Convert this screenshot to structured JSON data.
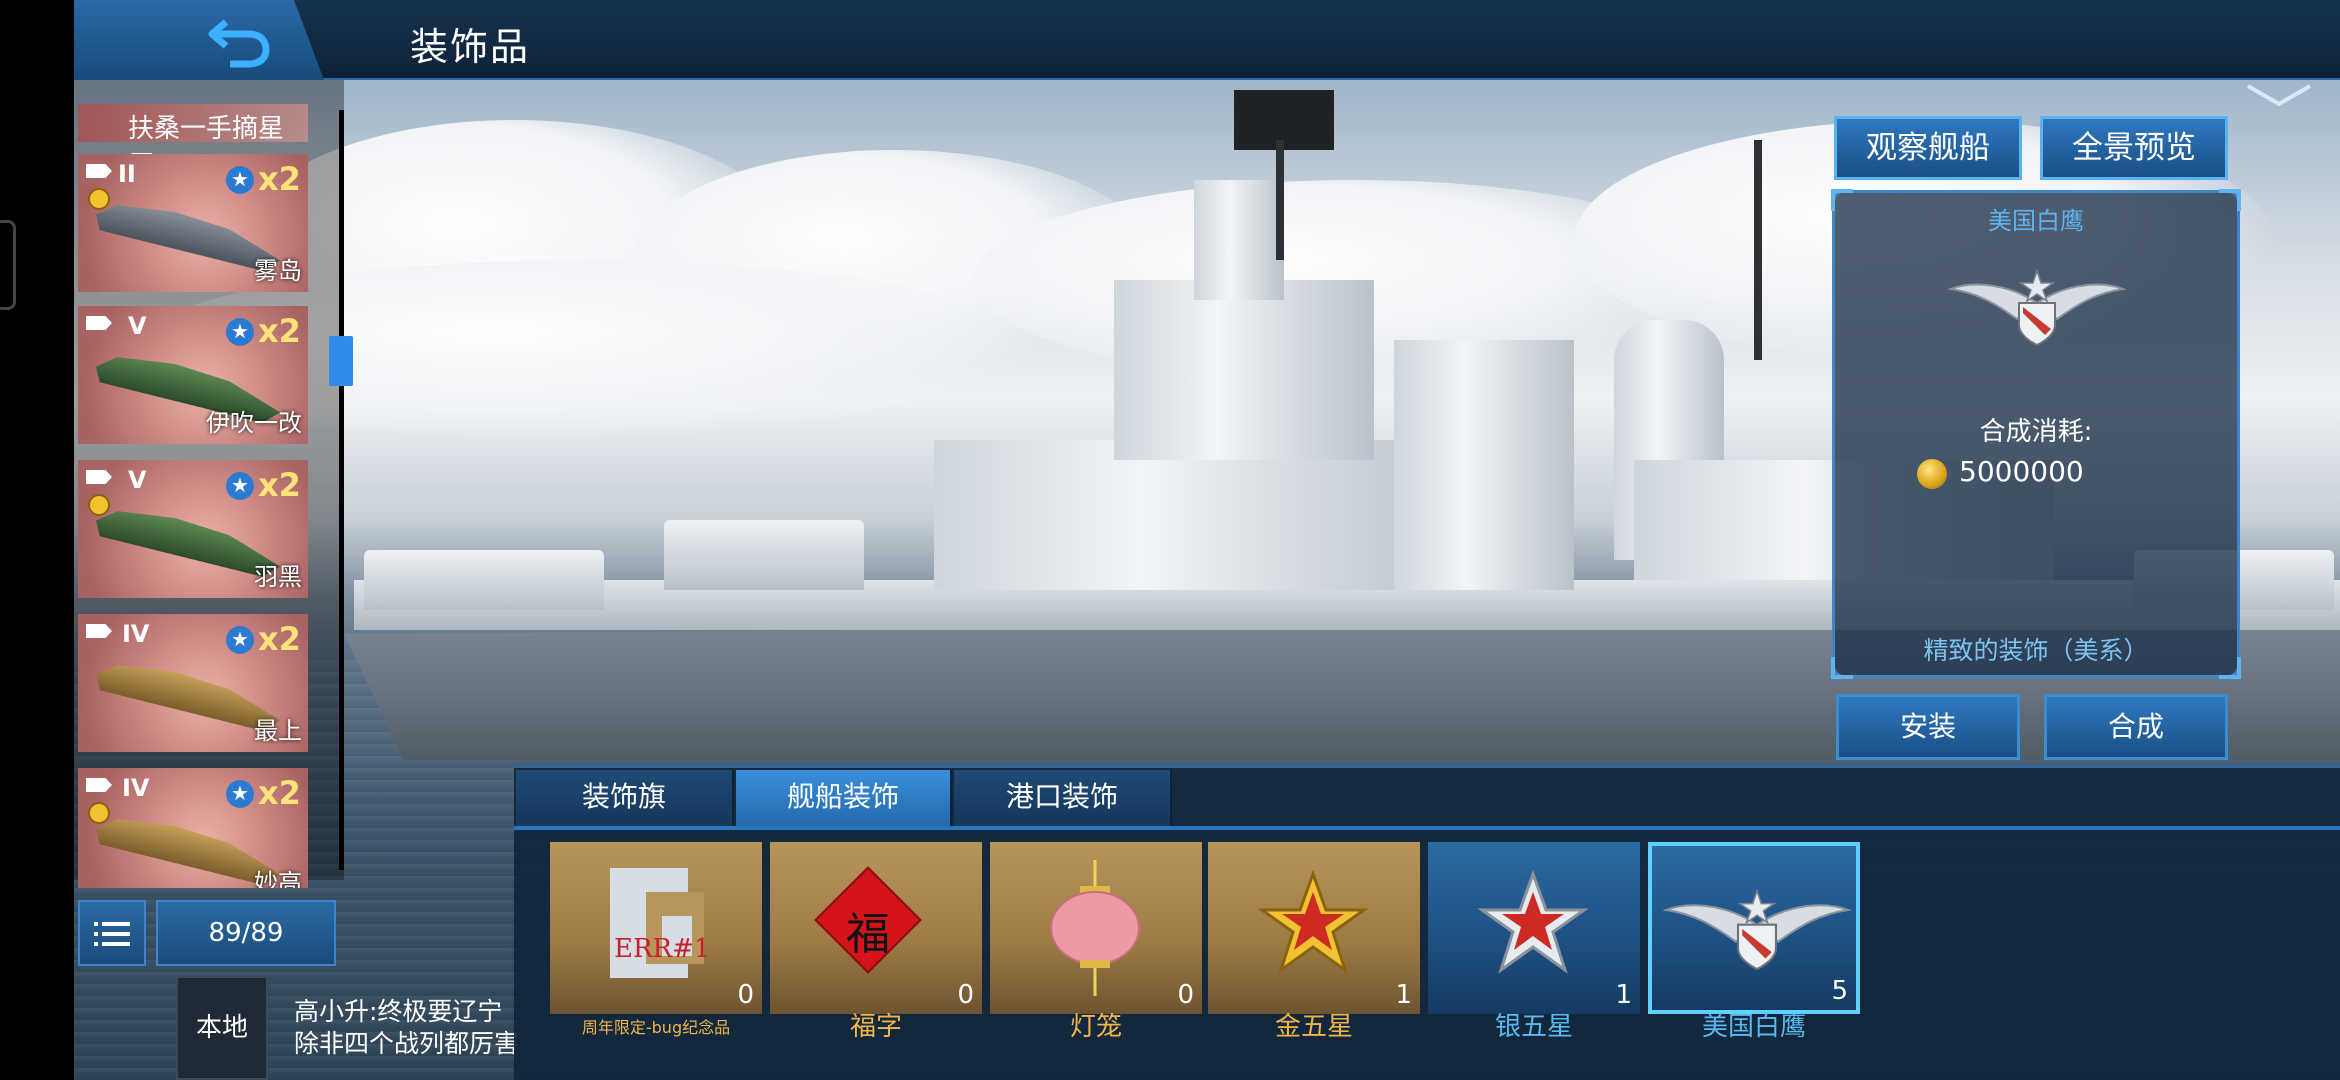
{
  "header": {
    "title": "装饰品",
    "back_label": "back"
  },
  "ship_list": {
    "header_text": "扶桑一手摘星辰",
    "items": [
      {
        "tier": "II",
        "multiplier": "x2",
        "name": "雾岛",
        "model": "grey"
      },
      {
        "tier": "V",
        "multiplier": "x2",
        "name": "伊吹一改",
        "model": "green"
      },
      {
        "tier": "V",
        "multiplier": "x2",
        "name": "羽黑",
        "model": "green"
      },
      {
        "tier": "IV",
        "multiplier": "x2",
        "name": "最上",
        "model": "orange"
      },
      {
        "tier": "IV",
        "multiplier": "x2",
        "name": "妙高",
        "model": "orange"
      }
    ],
    "count": "89/89",
    "local_tab": "本地",
    "chat": [
      "高小升:终极要辽宁",
      "除非四个战列都厉害"
    ]
  },
  "top_buttons": {
    "observe": "观察舰船",
    "panorama": "全景预览"
  },
  "detail": {
    "item_name": "美国白鹰",
    "cost_label": "合成消耗:",
    "cost_value": "5000000",
    "description": "精致的装饰（美系）"
  },
  "actions": {
    "install": "安装",
    "combine": "合成"
  },
  "tabs": [
    {
      "label": "装饰旗",
      "active": false
    },
    {
      "label": "舰船装饰",
      "active": true
    },
    {
      "label": "港口装饰",
      "active": false
    }
  ],
  "items": [
    {
      "name": "周年限定-bug纪念品",
      "count": "0",
      "icon": "err-icon",
      "style": "gold",
      "icon_text": "ERR#1"
    },
    {
      "name": "福字",
      "count": "0",
      "icon": "fu-icon",
      "style": "gold",
      "icon_text": "福"
    },
    {
      "name": "灯笼",
      "count": "0",
      "icon": "lantern-icon",
      "style": "gold"
    },
    {
      "name": "金五星",
      "count": "1",
      "icon": "gold-star-icon",
      "style": "gold"
    },
    {
      "name": "银五星",
      "count": "1",
      "icon": "silver-star-icon",
      "style": "blue"
    },
    {
      "name": "美国白鹰",
      "count": "5",
      "icon": "eagle-icon",
      "style": "blue",
      "selected": true
    }
  ],
  "colors": {
    "accent": "#3a8fdb",
    "gold_label": "#f1b54a",
    "blue_label": "#58b9f0"
  }
}
